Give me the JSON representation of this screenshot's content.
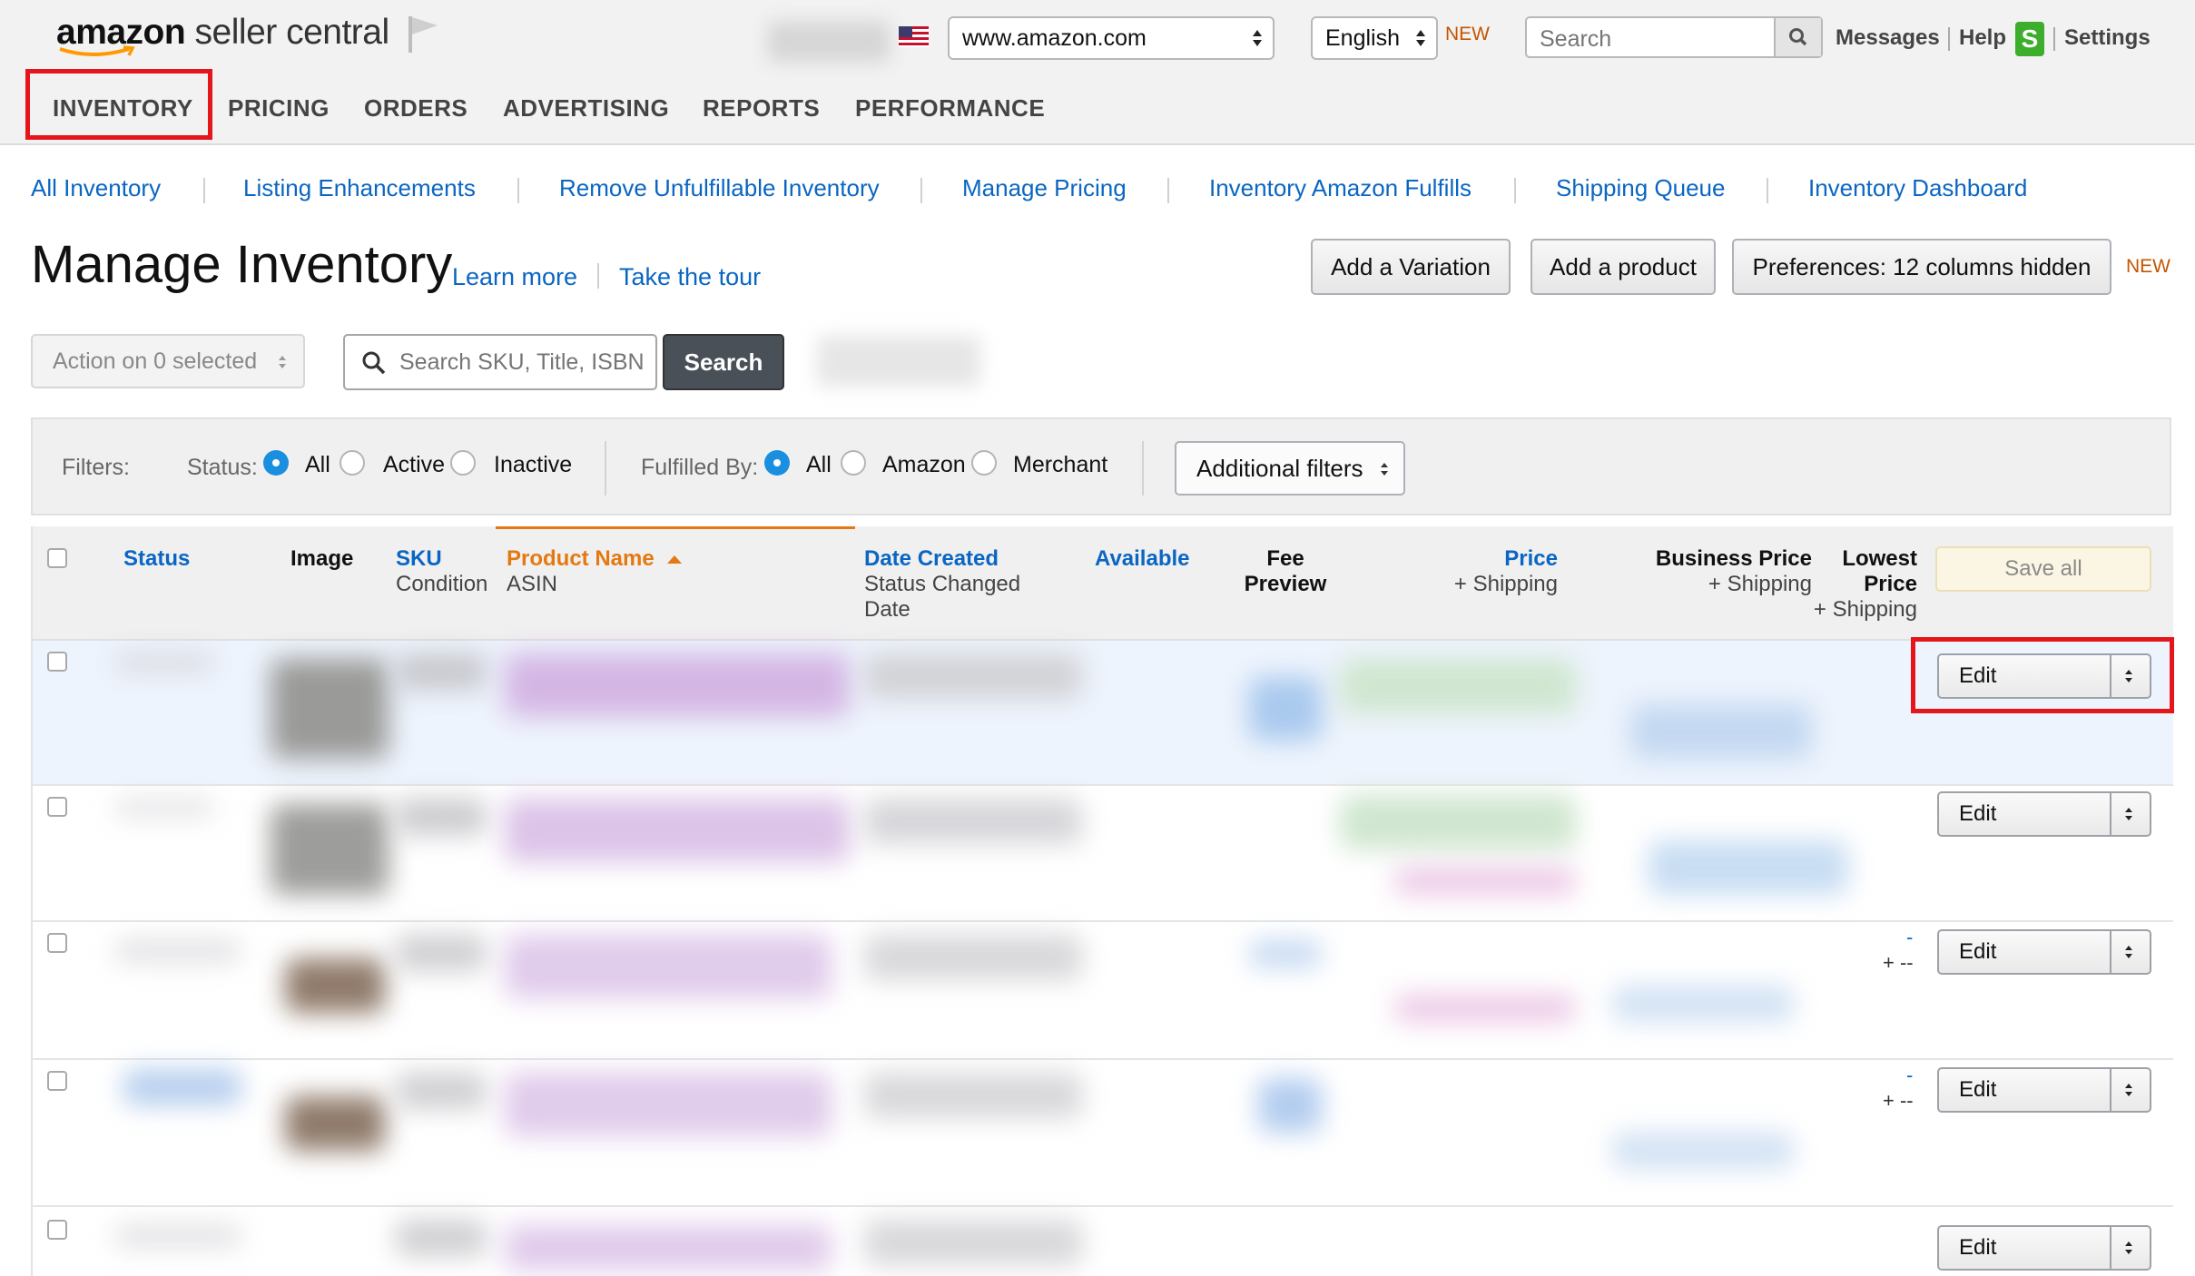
{
  "header": {
    "logo_brand": "amazon",
    "logo_product": "seller central",
    "marketplace": "www.amazon.com",
    "language": "English",
    "language_badge": "NEW",
    "search_placeholder": "Search",
    "links": {
      "messages": "Messages",
      "help": "Help",
      "help_badge": "S",
      "settings": "Settings"
    }
  },
  "nav": {
    "items": [
      "INVENTORY",
      "PRICING",
      "ORDERS",
      "ADVERTISING",
      "REPORTS",
      "PERFORMANCE"
    ],
    "active": "INVENTORY"
  },
  "subnav": {
    "items": [
      "All Inventory",
      "Listing Enhancements",
      "Remove Unfulfillable Inventory",
      "Manage Pricing",
      "Inventory Amazon Fulfills",
      "Shipping Queue",
      "Inventory Dashboard"
    ]
  },
  "page": {
    "title": "Manage Inventory",
    "learn_more": "Learn more",
    "take_tour": "Take the tour",
    "buttons": {
      "add_variation": "Add a Variation",
      "add_product": "Add a product",
      "preferences": "Preferences: 12 columns hidden",
      "preferences_badge": "NEW"
    }
  },
  "actions": {
    "bulk_action": "Action on 0 selected",
    "search_placeholder": "Search SKU, Title, ISBN",
    "search_button": "Search"
  },
  "filters": {
    "label": "Filters:",
    "status_label": "Status:",
    "status_options": [
      "All",
      "Active",
      "Inactive"
    ],
    "status_selected": "All",
    "fulfilled_label": "Fulfilled By:",
    "fulfilled_options": [
      "All",
      "Amazon",
      "Merchant"
    ],
    "fulfilled_selected": "All",
    "additional": "Additional filters"
  },
  "table": {
    "columns": {
      "status": "Status",
      "image": "Image",
      "sku": "SKU",
      "sku_sub": "Condition",
      "product_name": "Product Name",
      "product_sub": "ASIN",
      "date_created": "Date Created",
      "date_sub1": "Status Changed",
      "date_sub2": "Date",
      "available": "Available",
      "fee1": "Fee",
      "fee2": "Preview",
      "price": "Price",
      "price_sub": "+ Shipping",
      "business_price": "Business Price",
      "business_sub": "+ Shipping",
      "lowest1": "Lowest",
      "lowest2": "Price",
      "lowest_sub": "+ Shipping"
    },
    "save_all": "Save all",
    "edit_label": "Edit",
    "lowest_dash": "-",
    "lowest_ship_dash": "+ --"
  },
  "colors": {
    "link": "#0a66c2",
    "sorted_column": "#e47911",
    "highlight_box": "#e4161c",
    "new_badge": "#c45500"
  }
}
